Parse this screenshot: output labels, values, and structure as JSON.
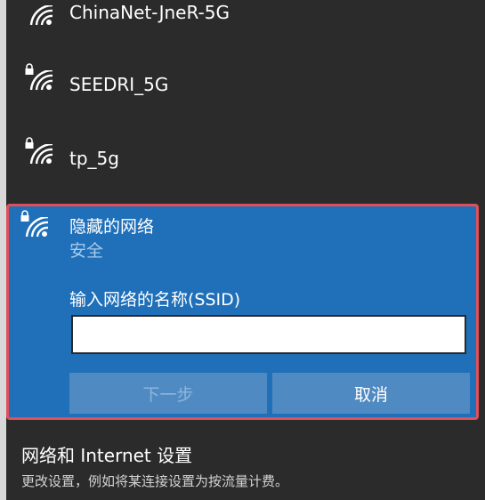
{
  "networks": [
    {
      "name": "ChinaNet-JneR-5G",
      "secured": false
    },
    {
      "name": "SEEDRI_5G",
      "secured": true
    },
    {
      "name": "tp_5g",
      "secured": true
    }
  ],
  "hidden_network": {
    "title": "隐藏的网络",
    "status": "安全",
    "ssid_label": "输入网络的名称(SSID)",
    "ssid_value": "",
    "next_label": "下一步",
    "cancel_label": "取消"
  },
  "settings": {
    "link": "网络和 Internet 设置",
    "description": "更改设置，例如将某连接设置为按流量计费。"
  },
  "colors": {
    "panel": "#1f6fb9",
    "highlight_border": "#e0505a",
    "button": "#4f8ac2"
  }
}
